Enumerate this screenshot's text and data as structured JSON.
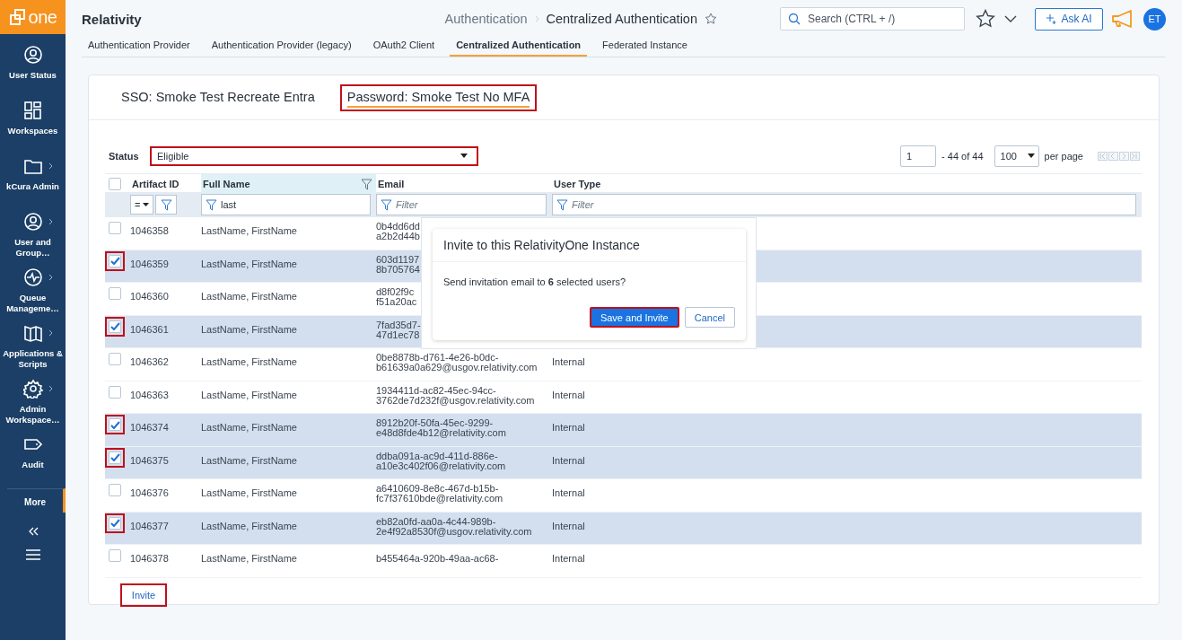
{
  "app": {
    "logo": "one",
    "title": "Relativity"
  },
  "sidebar": {
    "items": [
      {
        "label": "User Status",
        "has_submenu": false
      },
      {
        "label": "Workspaces",
        "has_submenu": false
      },
      {
        "label": "kCura Admin",
        "has_submenu": true
      },
      {
        "label": "User and Group…",
        "has_submenu": true
      },
      {
        "label": "Queue Manageme…",
        "has_submenu": true
      },
      {
        "label": "Applications & Scripts",
        "has_submenu": true
      },
      {
        "label": "Admin Workspace…",
        "has_submenu": true
      },
      {
        "label": "Audit",
        "has_submenu": false
      }
    ],
    "more": "More"
  },
  "breadcrumb": [
    "Authentication",
    "Centralized Authentication"
  ],
  "search": {
    "placeholder": "Search (CTRL + /)"
  },
  "ask_ai": "Ask AI",
  "avatar": "ET",
  "tabs": [
    {
      "label": "Authentication Provider",
      "selected": false
    },
    {
      "label": "Authentication Provider (legacy)",
      "selected": false
    },
    {
      "label": "OAuth2 Client",
      "selected": false
    },
    {
      "label": "Centralized Authentication",
      "selected": true
    },
    {
      "label": "Federated Instance",
      "selected": false
    }
  ],
  "provider_tabs": [
    {
      "label": "SSO: Smoke Test Recreate Entra",
      "selected": false,
      "highlighted": false
    },
    {
      "label": "Password: Smoke Test No MFA",
      "selected": true,
      "highlighted": true
    }
  ],
  "status_filter": {
    "label": "Status",
    "value": "Eligible",
    "highlighted": true
  },
  "pagination": {
    "page": "1",
    "range": "- 44 of 44",
    "page_size": "100",
    "per_page": "per page"
  },
  "table": {
    "select_all": {
      "checked": false
    },
    "columns": [
      {
        "label": "Artifact ID",
        "filtered": false
      },
      {
        "label": "Full Name",
        "filtered": true
      },
      {
        "label": "Email",
        "filtered": false
      },
      {
        "label": "User Type",
        "filtered": false
      }
    ],
    "filters": {
      "operator": "=",
      "full_name": "last",
      "email_placeholder": "Filter",
      "user_type_placeholder": "Filter"
    },
    "rows": [
      {
        "artifact_id": "1046358",
        "full_name": "LastName, FirstName",
        "email": "0b4dd6dd\na2b2d44b",
        "checked": false,
        "highlighted": false
      },
      {
        "artifact_id": "1046359",
        "full_name": "LastName, FirstName",
        "email": "603d1197\n8b705764",
        "checked": true,
        "highlighted": true
      },
      {
        "artifact_id": "1046360",
        "full_name": "LastName, FirstName",
        "email": "d8f02f9c\nf51a20ac",
        "checked": false,
        "highlighted": false
      },
      {
        "artifact_id": "1046361",
        "full_name": "LastName, FirstName",
        "email": "7fad35d7-\n47d1ec78",
        "checked": true,
        "highlighted": true
      },
      {
        "artifact_id": "1046362",
        "full_name": "LastName, FirstName",
        "email": "0be8878b-d761-4e26-b0dc-\nb61639a0a629@usgov.relativity.com",
        "user_type": "Internal",
        "checked": false,
        "highlighted": false
      },
      {
        "artifact_id": "1046363",
        "full_name": "LastName, FirstName",
        "email": "1934411d-ac82-45ec-94cc-\n3762de7d232f@usgov.relativity.com",
        "user_type": "Internal",
        "checked": false,
        "highlighted": false
      },
      {
        "artifact_id": "1046374",
        "full_name": "LastName, FirstName",
        "email": "8912b20f-50fa-45ec-9299-\ne48d8fde4b12@relativity.com",
        "user_type": "Internal",
        "checked": true,
        "highlighted": true
      },
      {
        "artifact_id": "1046375",
        "full_name": "LastName, FirstName",
        "email": "ddba091a-ac9d-411d-886e-\na10e3c402f06@relativity.com",
        "user_type": "Internal",
        "checked": true,
        "highlighted": true
      },
      {
        "artifact_id": "1046376",
        "full_name": "LastName, FirstName",
        "email": "a6410609-8e8c-467d-b15b-\nfc7f37610bde@relativity.com",
        "user_type": "Internal",
        "checked": false,
        "highlighted": false
      },
      {
        "artifact_id": "1046377",
        "full_name": "LastName, FirstName",
        "email": "eb82a0fd-aa0a-4c44-989b-\n2e4f92a8530f@usgov.relativity.com",
        "user_type": "Internal",
        "checked": true,
        "highlighted": true
      },
      {
        "artifact_id": "1046378",
        "full_name": "LastName, FirstName",
        "email": "b455464a-920b-49aa-ac68-",
        "user_type": "Internal",
        "checked": false,
        "highlighted": false
      }
    ]
  },
  "invite_button": {
    "label": "Invite",
    "highlighted": true
  },
  "dialog": {
    "title": "Invite to this RelativityOne Instance",
    "message": "Send invitation email to **6** selected users?",
    "buttons": [
      {
        "label": "Save and Invite",
        "kind": "primary",
        "highlighted": true
      },
      {
        "label": "Cancel",
        "kind": "secondary",
        "highlighted": false
      }
    ]
  }
}
